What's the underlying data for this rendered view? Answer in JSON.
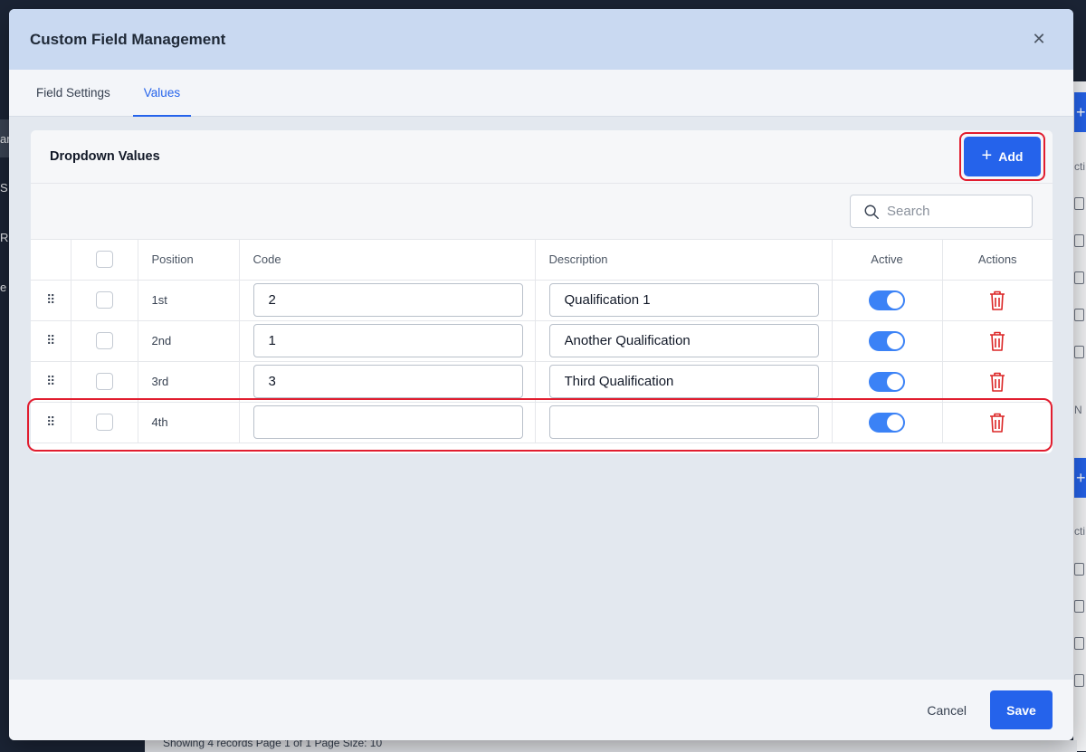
{
  "background": {
    "left_fragments": [
      "an",
      "S",
      "R",
      "e"
    ],
    "right_fragments": [
      "cti",
      "N",
      "cti"
    ],
    "footer_text": "Showing 4 records    Page 1 of 1    Page Size: 10"
  },
  "modal": {
    "title": "Custom Field Management",
    "close_icon": "close-icon",
    "tabs": [
      {
        "label": "Field Settings",
        "active": false
      },
      {
        "label": "Values",
        "active": true
      }
    ],
    "card": {
      "title": "Dropdown Values",
      "add_label": "Add",
      "search": {
        "placeholder": "Search",
        "value": ""
      },
      "columns": {
        "position": "Position",
        "code": "Code",
        "description": "Description",
        "active": "Active",
        "actions": "Actions"
      },
      "rows": [
        {
          "position": "1st",
          "code": "2",
          "description": "Qualification 1",
          "active": true
        },
        {
          "position": "2nd",
          "code": "1",
          "description": "Another Qualification",
          "active": true
        },
        {
          "position": "3rd",
          "code": "3",
          "description": "Third Qualification",
          "active": true
        },
        {
          "position": "4th",
          "code": "",
          "description": "",
          "active": true
        }
      ]
    },
    "footer": {
      "cancel_label": "Cancel",
      "save_label": "Save"
    }
  },
  "colors": {
    "accent": "#2563eb",
    "highlight": "#e11d2f",
    "header_bg": "#c9d9f1",
    "delete_icon": "#dc2626"
  }
}
